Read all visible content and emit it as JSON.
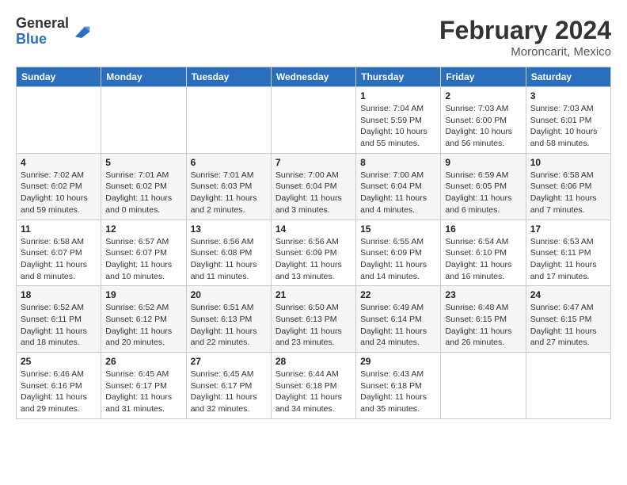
{
  "header": {
    "logo_general": "General",
    "logo_blue": "Blue",
    "month_year": "February 2024",
    "location": "Moroncarit, Mexico"
  },
  "days_of_week": [
    "Sunday",
    "Monday",
    "Tuesday",
    "Wednesday",
    "Thursday",
    "Friday",
    "Saturday"
  ],
  "weeks": [
    [
      {
        "day": "",
        "info": ""
      },
      {
        "day": "",
        "info": ""
      },
      {
        "day": "",
        "info": ""
      },
      {
        "day": "",
        "info": ""
      },
      {
        "day": "1",
        "info": "Sunrise: 7:04 AM\nSunset: 5:59 PM\nDaylight: 10 hours and 55 minutes."
      },
      {
        "day": "2",
        "info": "Sunrise: 7:03 AM\nSunset: 6:00 PM\nDaylight: 10 hours and 56 minutes."
      },
      {
        "day": "3",
        "info": "Sunrise: 7:03 AM\nSunset: 6:01 PM\nDaylight: 10 hours and 58 minutes."
      }
    ],
    [
      {
        "day": "4",
        "info": "Sunrise: 7:02 AM\nSunset: 6:02 PM\nDaylight: 10 hours and 59 minutes."
      },
      {
        "day": "5",
        "info": "Sunrise: 7:01 AM\nSunset: 6:02 PM\nDaylight: 11 hours and 0 minutes."
      },
      {
        "day": "6",
        "info": "Sunrise: 7:01 AM\nSunset: 6:03 PM\nDaylight: 11 hours and 2 minutes."
      },
      {
        "day": "7",
        "info": "Sunrise: 7:00 AM\nSunset: 6:04 PM\nDaylight: 11 hours and 3 minutes."
      },
      {
        "day": "8",
        "info": "Sunrise: 7:00 AM\nSunset: 6:04 PM\nDaylight: 11 hours and 4 minutes."
      },
      {
        "day": "9",
        "info": "Sunrise: 6:59 AM\nSunset: 6:05 PM\nDaylight: 11 hours and 6 minutes."
      },
      {
        "day": "10",
        "info": "Sunrise: 6:58 AM\nSunset: 6:06 PM\nDaylight: 11 hours and 7 minutes."
      }
    ],
    [
      {
        "day": "11",
        "info": "Sunrise: 6:58 AM\nSunset: 6:07 PM\nDaylight: 11 hours and 8 minutes."
      },
      {
        "day": "12",
        "info": "Sunrise: 6:57 AM\nSunset: 6:07 PM\nDaylight: 11 hours and 10 minutes."
      },
      {
        "day": "13",
        "info": "Sunrise: 6:56 AM\nSunset: 6:08 PM\nDaylight: 11 hours and 11 minutes."
      },
      {
        "day": "14",
        "info": "Sunrise: 6:56 AM\nSunset: 6:09 PM\nDaylight: 11 hours and 13 minutes."
      },
      {
        "day": "15",
        "info": "Sunrise: 6:55 AM\nSunset: 6:09 PM\nDaylight: 11 hours and 14 minutes."
      },
      {
        "day": "16",
        "info": "Sunrise: 6:54 AM\nSunset: 6:10 PM\nDaylight: 11 hours and 16 minutes."
      },
      {
        "day": "17",
        "info": "Sunrise: 6:53 AM\nSunset: 6:11 PM\nDaylight: 11 hours and 17 minutes."
      }
    ],
    [
      {
        "day": "18",
        "info": "Sunrise: 6:52 AM\nSunset: 6:11 PM\nDaylight: 11 hours and 18 minutes."
      },
      {
        "day": "19",
        "info": "Sunrise: 6:52 AM\nSunset: 6:12 PM\nDaylight: 11 hours and 20 minutes."
      },
      {
        "day": "20",
        "info": "Sunrise: 6:51 AM\nSunset: 6:13 PM\nDaylight: 11 hours and 22 minutes."
      },
      {
        "day": "21",
        "info": "Sunrise: 6:50 AM\nSunset: 6:13 PM\nDaylight: 11 hours and 23 minutes."
      },
      {
        "day": "22",
        "info": "Sunrise: 6:49 AM\nSunset: 6:14 PM\nDaylight: 11 hours and 24 minutes."
      },
      {
        "day": "23",
        "info": "Sunrise: 6:48 AM\nSunset: 6:15 PM\nDaylight: 11 hours and 26 minutes."
      },
      {
        "day": "24",
        "info": "Sunrise: 6:47 AM\nSunset: 6:15 PM\nDaylight: 11 hours and 27 minutes."
      }
    ],
    [
      {
        "day": "25",
        "info": "Sunrise: 6:46 AM\nSunset: 6:16 PM\nDaylight: 11 hours and 29 minutes."
      },
      {
        "day": "26",
        "info": "Sunrise: 6:45 AM\nSunset: 6:17 PM\nDaylight: 11 hours and 31 minutes."
      },
      {
        "day": "27",
        "info": "Sunrise: 6:45 AM\nSunset: 6:17 PM\nDaylight: 11 hours and 32 minutes."
      },
      {
        "day": "28",
        "info": "Sunrise: 6:44 AM\nSunset: 6:18 PM\nDaylight: 11 hours and 34 minutes."
      },
      {
        "day": "29",
        "info": "Sunrise: 6:43 AM\nSunset: 6:18 PM\nDaylight: 11 hours and 35 minutes."
      },
      {
        "day": "",
        "info": ""
      },
      {
        "day": "",
        "info": ""
      }
    ]
  ]
}
